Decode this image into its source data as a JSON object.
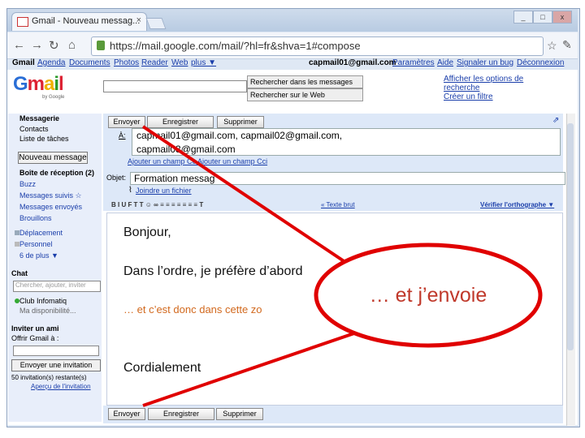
{
  "browser": {
    "tab_title": "Gmail - Nouveau messag...",
    "tab_close": "×",
    "url": "https://mail.google.com/mail/?hl=fr&shva=1#compose",
    "win_controls": [
      "_",
      "□",
      "x"
    ]
  },
  "top_links": {
    "left": [
      "Gmail",
      "Agenda",
      "Documents",
      "Photos",
      "Reader",
      "Web",
      "plus ▼"
    ],
    "account": "capmail01@gmail.com",
    "right": [
      "Paramètres",
      "Aide",
      "Signaler un bug",
      "Déconnexion"
    ],
    "separator": "|"
  },
  "logo": {
    "parts": [
      "G",
      "m",
      "a",
      "i",
      "l"
    ],
    "sub": "by Google"
  },
  "search": {
    "button_mail": "Rechercher dans les messages",
    "button_web": "Rechercher sur le Web",
    "links": [
      "Afficher les options de",
      "recherche",
      "Créer un filtre"
    ]
  },
  "left_nav": {
    "items_top": [
      "Messagerie",
      "Contacts",
      "Liste de tâches"
    ],
    "compose_button": "Nouveau message",
    "folders": [
      "Boîte de réception (2)",
      "Buzz",
      "Messages suivis ☆",
      "Messages envoyés",
      "Brouillons"
    ],
    "labels": [
      "Déplacement",
      "Personnel",
      "6 de plus ▼"
    ],
    "chat_title": "Chat",
    "chat_placeholder": "Chercher, ajouter, inviter",
    "chat_user": "Club Infomatiq",
    "chat_status": "Ma disponibilité...",
    "invite_title": "Inviter un ami",
    "invite_sub": "Offrir Gmail à :",
    "invite_button": "Envoyer une invitation",
    "invite_remaining": "50 invitation(s) restante(s)",
    "invite_preview": "Aperçu de l'invitation"
  },
  "compose": {
    "send": "Envoyer",
    "save": "Enregistrer",
    "delete": "Supprimer",
    "to_label": "À:",
    "to_line1": "capmail01@gmail.com, capmail02@gmail.com,",
    "to_line2": "capmail03@gmail.com",
    "add_links": "Ajouter un champ Cc   Ajouter un champ Cci",
    "subject_label": "Objet:",
    "subject": "Formation messag",
    "attach": "Joindre un fichier",
    "format_link": "« Texte brut",
    "spellcheck": "Vérifier l'orthographe ▼",
    "format_icons": "B  I  U  F  T  T  ☺  ∞  ≡  ≡  ≡  ≡  ≡  ≡  ≡  T"
  },
  "body": {
    "line1": "Bonjour,",
    "line2": "Dans l’ordre, je préfère d’abord",
    "line3": "… et c’est donc dans cette zo",
    "line4": "Cordialement"
  },
  "callout": {
    "text": "… et j’envoie"
  },
  "footer": {
    "send": "Envoyer",
    "save": "Enregistrer",
    "delete": "Supprimer"
  },
  "colors": {
    "annotation_red": "#e00000",
    "callout_text": "#c0392b",
    "link_blue": "#1a3eaa"
  }
}
